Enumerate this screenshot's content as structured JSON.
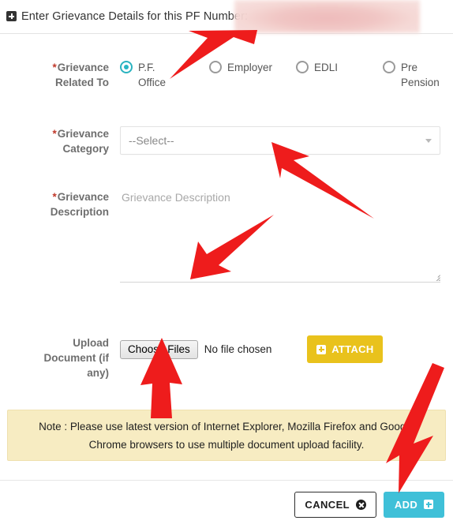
{
  "header": {
    "title": "Enter Grievance Details for this PF Number:",
    "plus_icon": "plus-square-icon",
    "redacted_value": ""
  },
  "form": {
    "related_to": {
      "label": "Grievance",
      "label_line2": "Related To",
      "required_mark": "*",
      "options": [
        {
          "label": "P.F.",
          "label_line2": "Office",
          "selected": true
        },
        {
          "label": "Employer",
          "label_line2": "",
          "selected": false
        },
        {
          "label": "EDLI",
          "label_line2": "",
          "selected": false
        },
        {
          "label": "Pre",
          "label_line2": "Pension",
          "selected": false
        }
      ]
    },
    "category": {
      "label": "Grievance",
      "label_line2": "Category",
      "required_mark": "*",
      "selected_value": "--Select--",
      "caret_icon": "chevron-down-icon"
    },
    "description": {
      "label": "Grievance",
      "label_line2": "Description",
      "required_mark": "*",
      "placeholder": "Grievance Description",
      "value": "",
      "resize_icon": "resize-grip-icon"
    },
    "upload": {
      "label_line1": "Upload",
      "label_line2": "Document (if",
      "label_line3": "any)",
      "choose_files_label": "Choose Files",
      "file_status": "No file chosen",
      "attach_label": "ATTACH",
      "attach_icon": "plus-square-icon"
    }
  },
  "note": {
    "line1": "Note : Please use latest version of Internet Explorer, Mozilla Firefox and Google",
    "line2": "Chrome browsers to use multiple document upload facility."
  },
  "footer": {
    "cancel_label": "CANCEL",
    "cancel_icon": "circle-x-icon",
    "add_label": "ADD",
    "add_icon": "plus-square-icon"
  },
  "annotations": {
    "arrow_color": "#ee1c1c",
    "arrows": [
      {
        "name": "arrow-to-pf-office-radio",
        "points_to": "P.F. Office radio"
      },
      {
        "name": "arrow-to-grievance-category-select",
        "points_to": "Grievance Category select"
      },
      {
        "name": "arrow-to-grievance-description-textarea",
        "points_to": "Grievance Description textarea"
      },
      {
        "name": "arrow-to-choose-files-button",
        "points_to": "Choose Files button"
      },
      {
        "name": "arrow-to-add-button",
        "points_to": "ADD button"
      }
    ]
  },
  "colors": {
    "accent_teal": "#3fc0d8",
    "attach_yellow": "#e9c21c",
    "note_background": "#f7ecc2",
    "required_red": "#c0392b",
    "arrow_red": "#ee1c1c"
  }
}
